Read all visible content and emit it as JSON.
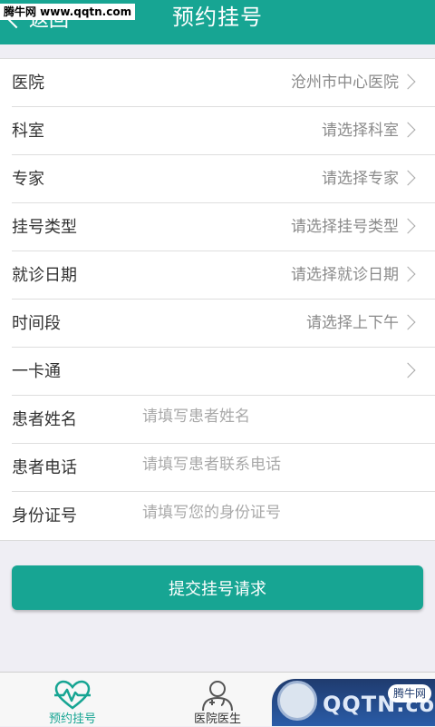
{
  "header": {
    "back_label": "返回",
    "title": "预约挂号",
    "watermark": "腾牛网 www.qqtn.com"
  },
  "form": {
    "rows": [
      {
        "label": "医院",
        "value": "沧州市中心医院"
      },
      {
        "label": "科室",
        "value": "请选择科室"
      },
      {
        "label": "专家",
        "value": "请选择专家"
      },
      {
        "label": "挂号类型",
        "value": "请选择挂号类型"
      },
      {
        "label": "就诊日期",
        "value": "请选择就诊日期"
      },
      {
        "label": "时间段",
        "value": "请选择上下午"
      },
      {
        "label": "一卡通",
        "value": ""
      }
    ],
    "inputs": [
      {
        "label": "患者姓名",
        "placeholder": "请填写患者姓名",
        "value": ""
      },
      {
        "label": "患者电话",
        "placeholder": "请填写患者联系电话",
        "value": ""
      },
      {
        "label": "身份证号",
        "placeholder": "请填写您的身份证号",
        "value": ""
      }
    ]
  },
  "submit_label": "提交挂号请求",
  "tabbar": {
    "tabs": [
      {
        "label": "预约挂号",
        "icon": "heartbeat-icon"
      },
      {
        "label": "医院医生",
        "icon": "doctor-icon"
      },
      {
        "label": "",
        "icon": "clipboard-icon"
      }
    ]
  },
  "brand": {
    "text": "QQTN.com",
    "tag": "腾牛网"
  },
  "colors": {
    "primary": "#17a593",
    "background": "#efeef4"
  }
}
